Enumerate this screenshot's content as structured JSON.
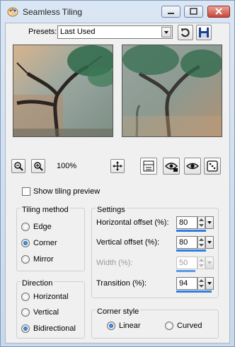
{
  "window": {
    "title": "Seamless Tiling"
  },
  "presets": {
    "label": "Presets:",
    "value": "Last Used"
  },
  "zoom": {
    "level": "100%"
  },
  "show_preview": {
    "label": "Show tiling preview",
    "checked": false
  },
  "tiling_method": {
    "title": "Tiling method",
    "options": [
      {
        "label": "Edge",
        "selected": false
      },
      {
        "label": "Corner",
        "selected": true
      },
      {
        "label": "Mirror",
        "selected": false
      }
    ]
  },
  "direction": {
    "title": "Direction",
    "options": [
      {
        "label": "Horizontal",
        "selected": false
      },
      {
        "label": "Vertical",
        "selected": false
      },
      {
        "label": "Bidirectional",
        "selected": true
      }
    ]
  },
  "settings": {
    "title": "Settings",
    "fields": [
      {
        "label": "Horizontal offset (%):",
        "value": "80",
        "level": 0.8,
        "enabled": true
      },
      {
        "label": "Vertical offset (%):",
        "value": "80",
        "level": 0.8,
        "enabled": true
      },
      {
        "label": "Width (%):",
        "value": "50",
        "level": 0.5,
        "enabled": false
      },
      {
        "label": "Transition (%):",
        "value": "94",
        "level": 0.94,
        "enabled": true
      }
    ]
  },
  "corner_style": {
    "title": "Corner style",
    "options": [
      {
        "label": "Linear",
        "selected": true
      },
      {
        "label": "Curved",
        "selected": false
      }
    ]
  },
  "icons": {
    "app": "paint-palette-icon",
    "zoom_out": "zoom-out-icon",
    "zoom_in": "zoom-in-icon",
    "pan": "move-icon",
    "save_preset": "save-icon",
    "reset_preset": "reset-icon"
  },
  "colors": {
    "accent": "#2f7de0",
    "radio_dot": "#1a4f9c"
  }
}
